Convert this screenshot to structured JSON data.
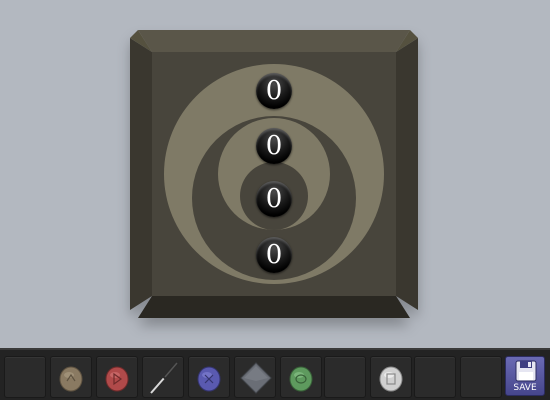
{
  "puzzle": {
    "digits": [
      "0",
      "0",
      "0",
      "0"
    ]
  },
  "inventory": {
    "items": [
      {
        "name": "",
        "icon": "empty"
      },
      {
        "name": "",
        "icon": "tan-rune-stone-icon"
      },
      {
        "name": "",
        "icon": "red-rune-stone-icon"
      },
      {
        "name": "",
        "icon": "screwdriver-icon"
      },
      {
        "name": "",
        "icon": "blue-rune-stone-icon"
      },
      {
        "name": "",
        "icon": "grey-tile-icon"
      },
      {
        "name": "",
        "icon": "green-rune-stone-icon"
      },
      {
        "name": "",
        "icon": "empty"
      },
      {
        "name": "",
        "icon": "white-rune-stone-icon"
      },
      {
        "name": "",
        "icon": "empty"
      },
      {
        "name": "",
        "icon": "empty"
      }
    ]
  },
  "save": {
    "label": "SAVE"
  },
  "colors": {
    "background": "#b3b8c0",
    "box": "#4a463d",
    "ring": "#8a8470",
    "toolbar": "#232323",
    "save": "#5a5aa0"
  }
}
